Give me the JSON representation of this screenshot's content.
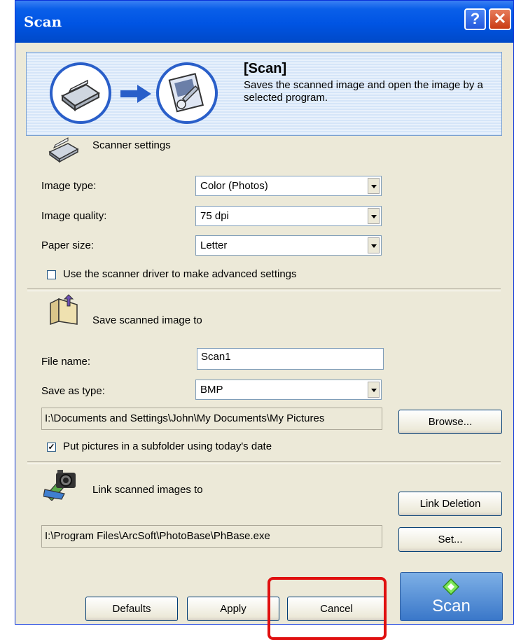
{
  "window": {
    "title": "Scan"
  },
  "banner": {
    "title": "[Scan]",
    "description": "Saves the scanned image and open the image by a selected program."
  },
  "scanner": {
    "section_title": "Scanner settings",
    "image_type_label": "Image type:",
    "image_type_value": "Color (Photos)",
    "image_quality_label": "Image quality:",
    "image_quality_value": "75 dpi",
    "paper_size_label": "Paper size:",
    "paper_size_value": "Letter",
    "advanced_label": "Use the scanner driver to make advanced settings",
    "advanced_checked": false
  },
  "save": {
    "section_title": "Save scanned image to",
    "file_name_label": "File name:",
    "file_name_value": "Scan1",
    "save_type_label": "Save as type:",
    "save_type_value": "BMP",
    "path": "I:\\Documents and Settings\\John\\My Documents\\My Pictures",
    "browse_label": "Browse...",
    "subfolder_label": "Put pictures in a subfolder using today's date",
    "subfolder_checked": true
  },
  "link": {
    "section_title": "Link scanned images to",
    "link_deletion_label": "Link Deletion",
    "program_path": "I:\\Program Files\\ArcSoft\\PhotoBase\\PhBase.exe",
    "set_label": "Set..."
  },
  "buttons": {
    "defaults": "Defaults",
    "apply": "Apply",
    "cancel": "Cancel",
    "scan": "Scan"
  },
  "colors": {
    "titlebar": "#0054e3",
    "highlight": "#e01010",
    "scan_button": "#5a94d8"
  }
}
